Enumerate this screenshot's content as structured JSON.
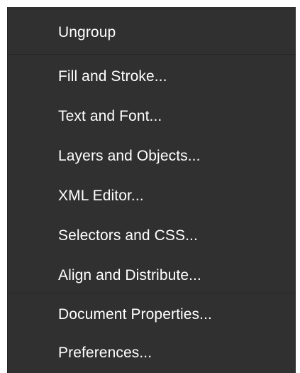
{
  "menu": {
    "items": [
      {
        "label": "Ungroup"
      },
      {
        "label": "Fill and Stroke..."
      },
      {
        "label": "Text and Font..."
      },
      {
        "label": "Layers and Objects..."
      },
      {
        "label": "XML Editor..."
      },
      {
        "label": "Selectors and CSS..."
      },
      {
        "label": "Align and Distribute..."
      },
      {
        "label": "Document Properties..."
      },
      {
        "label": "Preferences..."
      }
    ]
  }
}
